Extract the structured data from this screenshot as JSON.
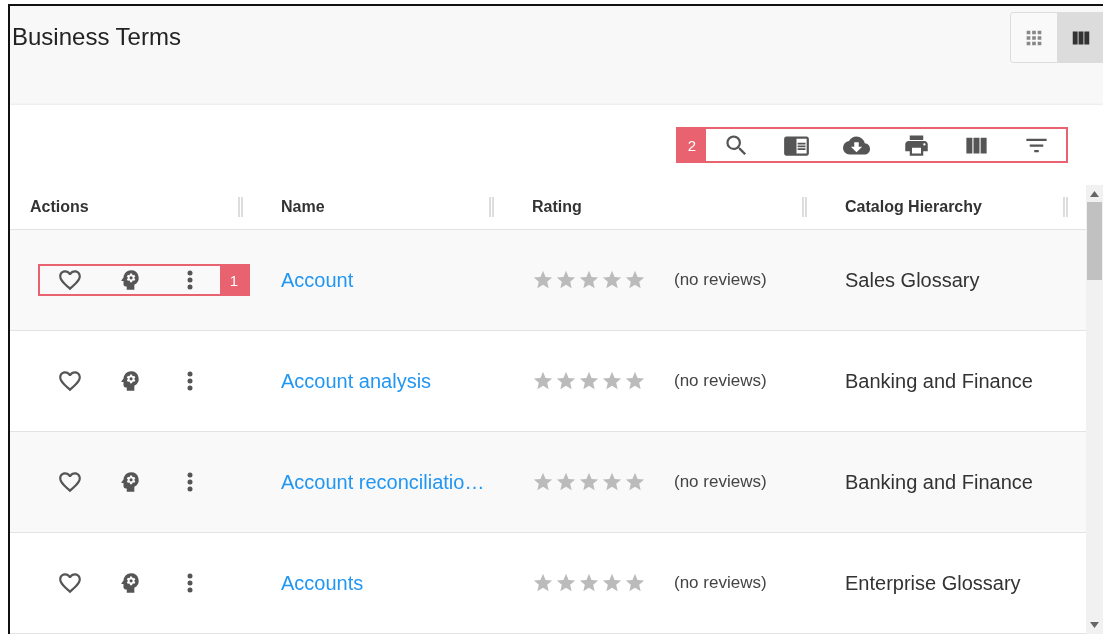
{
  "page": {
    "title": "Business Terms"
  },
  "view_toggle": [
    {
      "kind": "grid",
      "selected": false
    },
    {
      "kind": "columns",
      "selected": true
    }
  ],
  "toolbar": {
    "callout": "2",
    "tools": [
      {
        "kind": "search"
      },
      {
        "kind": "book"
      },
      {
        "kind": "download"
      },
      {
        "kind": "print"
      },
      {
        "kind": "columns"
      },
      {
        "kind": "filter"
      }
    ]
  },
  "table": {
    "columns": [
      "Actions",
      "Name",
      "Rating",
      "Catalog Hierarchy"
    ],
    "rows": [
      {
        "callout": "1",
        "name": "Account",
        "stars": 0,
        "reviews": "(no reviews)",
        "hierarchy": "Sales Glossary"
      },
      {
        "name": "Account analysis",
        "stars": 0,
        "reviews": "(no reviews)",
        "hierarchy": "Banking and Finance"
      },
      {
        "name": "Account reconciliatio…",
        "stars": 0,
        "reviews": "(no reviews)",
        "hierarchy": "Banking and Finance"
      },
      {
        "name": "Accounts",
        "stars": 0,
        "reviews": "(no reviews)",
        "hierarchy": "Enterprise Glossary"
      }
    ]
  }
}
